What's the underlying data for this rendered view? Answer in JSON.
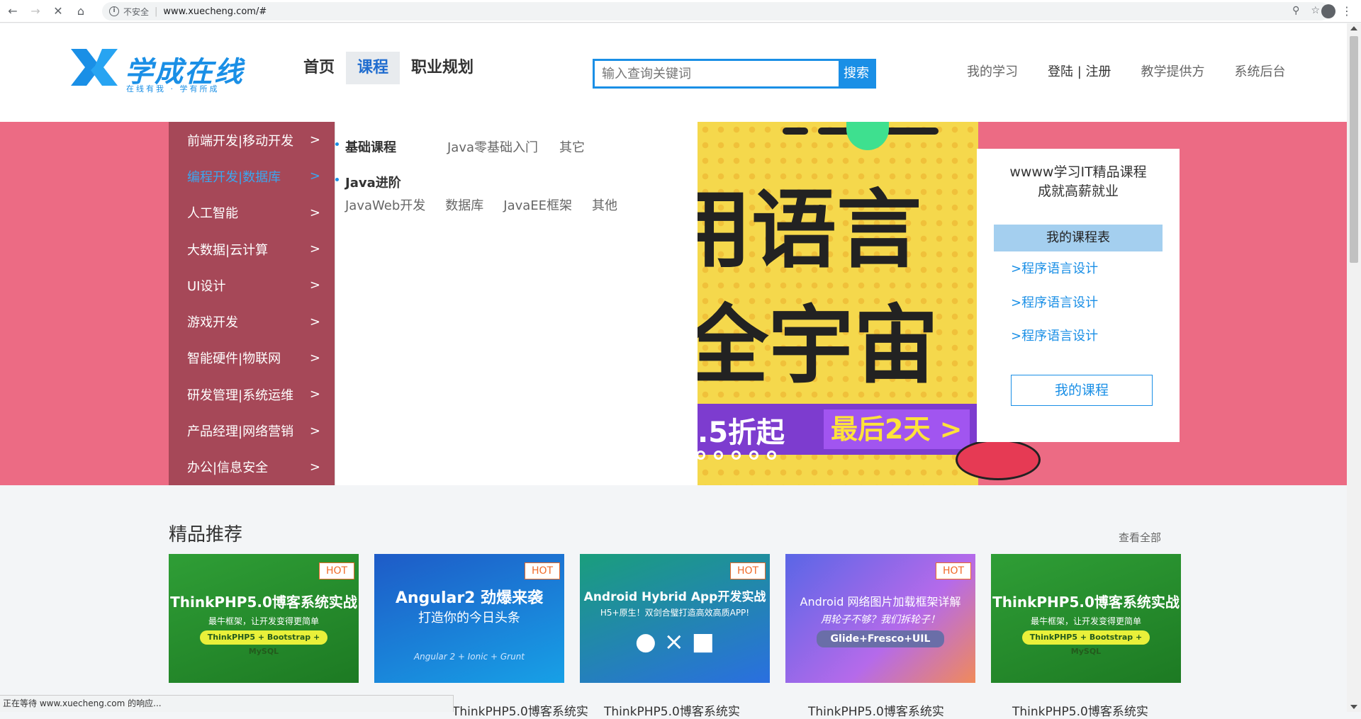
{
  "browser": {
    "security_label": "不安全",
    "url": "www.xuecheng.com/#"
  },
  "header": {
    "logo_text": "学成在线",
    "logo_slogan": "在线有我 · 学有所成",
    "nav": [
      "首页",
      "课程",
      "职业规划"
    ],
    "search_placeholder": "输入查询关键词",
    "search_button": "搜索",
    "links": {
      "my_learning": "我的学习",
      "login_register": "登陆 | 注册",
      "teaching_provider": "教学提供方",
      "system_backend": "系统后台"
    }
  },
  "categories": [
    {
      "label": "前端开发|移动开发",
      "arrow": ">"
    },
    {
      "label": "编程开发|数据库",
      "arrow": ">"
    },
    {
      "label": "人工智能",
      "arrow": ">"
    },
    {
      "label": "大数据|云计算",
      "arrow": ">"
    },
    {
      "label": "UI设计",
      "arrow": ">"
    },
    {
      "label": "游戏开发",
      "arrow": ">"
    },
    {
      "label": "智能硬件|物联网",
      "arrow": ">"
    },
    {
      "label": "研发管理|系统运维",
      "arrow": ">"
    },
    {
      "label": "产品经理|网络营销",
      "arrow": ">"
    },
    {
      "label": "办公|信息安全",
      "arrow": ">"
    }
  ],
  "submenu": {
    "group1": {
      "title": "基础课程",
      "links": [
        "Java零基础入门",
        "其它"
      ]
    },
    "group2": {
      "title": "Java进阶",
      "links": [
        "JavaWeb开发",
        "数据库",
        "JavaEE框架",
        "其他"
      ]
    }
  },
  "promo": {
    "line1": "用语言",
    "line2": "全宇宙",
    "discount": ".5折起",
    "last_days": "最后2天 >"
  },
  "side_panel": {
    "slogan_line1": "wwww学习IT精品课程",
    "slogan_line2": "成就高薪就业",
    "my_schedule": "我的课程表",
    "course_links": [
      ">程序语言设计",
      ">程序语言设计",
      ">程序语言设计"
    ],
    "my_course_button": "我的课程"
  },
  "recommend": {
    "title": "精品推荐",
    "view_all": "查看全部",
    "cards": [
      {
        "title": "ThinkPHP5.0博客系统实战",
        "sub": "最牛框架，让开发变得更简单",
        "pill": "ThinkPHP5 + Bootstrap + MySQL",
        "badge": "HOT"
      },
      {
        "title": "Angular2 劲爆来袭",
        "sub": "打造你的今日头条",
        "pill": "Angular 2 + Ionic + Grunt",
        "badge": "HOT"
      },
      {
        "title": "Android Hybrid App开发实战",
        "sub": "H5+原生！双剑合璧打造高效高质APP!",
        "pill": "",
        "badge": "HOT"
      },
      {
        "title": "Android 网络图片加载框架详解",
        "sub": "用轮子不够？我们拆轮子！",
        "pill": "Glide+Fresco+UIL",
        "badge": "HOT"
      },
      {
        "title": "ThinkPHP5.0博客系统实战",
        "sub": "最牛框架，让开发变得更简单",
        "pill": "ThinkPHP5 + Bootstrap + MySQL",
        "badge": ""
      }
    ],
    "captions": [
      "ThinkPHP5.0博客系统实",
      "ThinkPHP5.0博客系统实",
      "ThinkPHP5.0博客系统实",
      "ThinkPHP5.0博客系统实",
      "ThinkPHP5.0博客系统实"
    ]
  },
  "status_text": "正在等待 www.xuecheng.com 的响应..."
}
